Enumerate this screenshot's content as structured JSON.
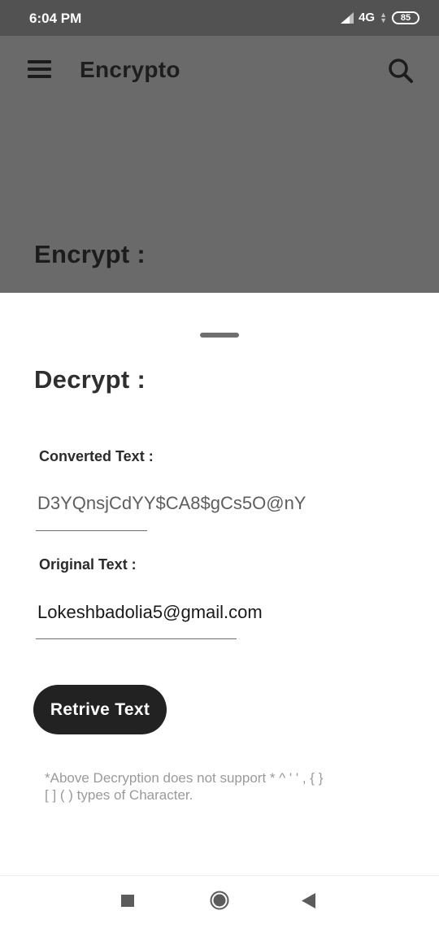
{
  "status_bar": {
    "time": "6:04 PM",
    "network": "4G",
    "battery": "85"
  },
  "app_bar": {
    "title": "Encrypto",
    "menu_icon": "hamburger-menu-icon",
    "search_icon": "search-icon"
  },
  "background_heading": "Encrypt :",
  "sheet": {
    "heading": "Decrypt :",
    "converted_label": "Converted Text :",
    "converted_value": "D3YQnsjCdYY$CA8$gCs5O@nY",
    "original_label": "Original Text :",
    "original_value": "Lokeshbadolia5@gmail.com",
    "button_label": "Retrive Text",
    "note_line1": "*Above Decryption does not support  * ^ ' ' , { }",
    "note_line2": "[ ] ( )  types of Character."
  },
  "nav_bar": {
    "recent_icon": "square-recents-icon",
    "home_icon": "circle-home-icon",
    "back_icon": "triangle-back-icon"
  },
  "colors": {
    "scrim": "#6a6a6a",
    "status_bar": "#525252",
    "button": "#222222",
    "note_text": "#9a9a9a"
  }
}
